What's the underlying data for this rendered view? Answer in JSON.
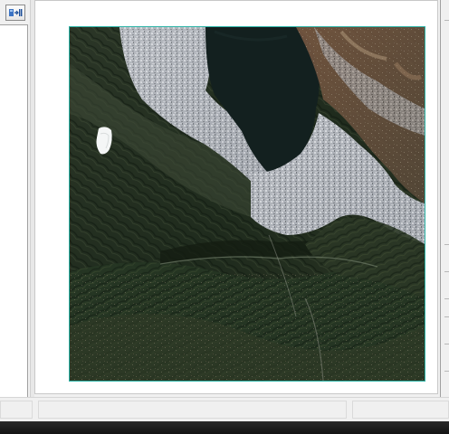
{
  "toolbar": {
    "tool_button_icon": "layer-navigate-icon"
  },
  "map": {
    "frame_color": "#2bb3a6",
    "image_kind": "satellite-imagery"
  },
  "status": {
    "cell_1": "",
    "cell_2": "",
    "cell_3": ""
  },
  "colors": {
    "panel_bg": "#f0f0f0",
    "taskbar": "#1c1c1c",
    "terrain_dark": "#1f2a1c",
    "lake": "#14201f",
    "urban": "#b9bcc2"
  }
}
